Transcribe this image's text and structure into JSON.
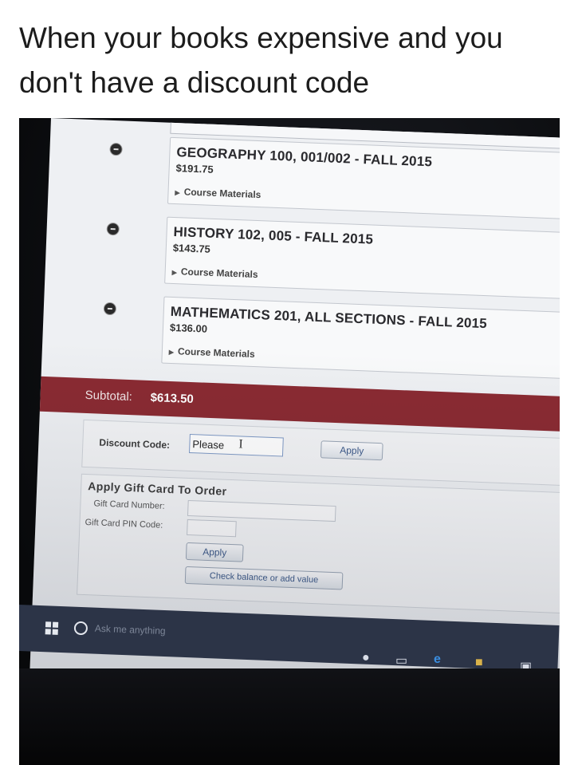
{
  "caption": {
    "line1": "When your books expensive and you",
    "line2": "don't have a discount code"
  },
  "courses": [
    {
      "name": "GEOGRAPHY 100, 001/002 - FALL 2015",
      "price": "$191.75",
      "materials": "Course Materials"
    },
    {
      "name": "HISTORY 102, 005 - FALL 2015",
      "price": "$143.75",
      "materials": "Course Materials"
    },
    {
      "name": "MATHEMATICS 201, ALL SECTIONS - FALL 2015",
      "price": "$136.00",
      "materials": "Course Materials"
    }
  ],
  "subtotal": {
    "label": "Subtotal:",
    "value": "$613.50"
  },
  "discount": {
    "label": "Discount Code:",
    "value": "Please",
    "apply_label": "Apply"
  },
  "gift_card": {
    "title": "Apply Gift Card To Order",
    "number_label": "Gift Card Number:",
    "pin_label": "Gift Card PIN Code:",
    "apply_label": "Apply",
    "check_label": "Check balance or add value"
  },
  "taskbar": {
    "search_placeholder": "Ask me anything"
  },
  "colors": {
    "subtotal_bar": "#8a2a32",
    "taskbar": "#2c3447",
    "button_text": "#3d5a8a"
  }
}
